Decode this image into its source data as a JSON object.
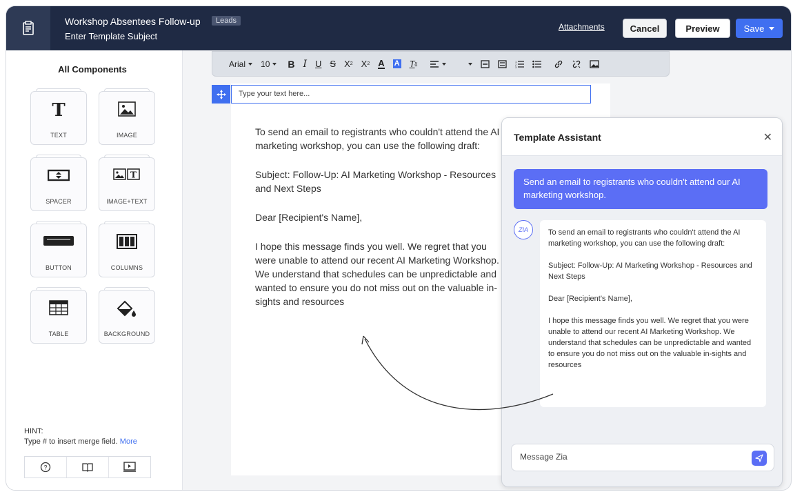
{
  "header": {
    "title": "Workshop Absentees Follow-up",
    "subtitle": "Enter Template Subject",
    "badge": "Leads",
    "attachments_label": "Attachments",
    "cancel_label": "Cancel",
    "preview_label": "Preview",
    "save_label": "Save"
  },
  "sidebar": {
    "title": "All Components",
    "components": [
      {
        "label": "TEXT",
        "icon": "text-icon"
      },
      {
        "label": "IMAGE",
        "icon": "image-icon"
      },
      {
        "label": "SPACER",
        "icon": "spacer-icon"
      },
      {
        "label": "IMAGE+TEXT",
        "icon": "image-text-icon"
      },
      {
        "label": "BUTTON",
        "icon": "button-icon"
      },
      {
        "label": "COLUMNS",
        "icon": "columns-icon"
      },
      {
        "label": "TABLE",
        "icon": "table-icon"
      },
      {
        "label": "BACKGROUND",
        "icon": "paint-bucket-icon"
      }
    ],
    "hint_label": "HINT:",
    "hint_text": "Type # to insert merge field.",
    "hint_more": "More"
  },
  "toolbar": {
    "font": "Arial",
    "size": "10"
  },
  "editor": {
    "subject_placeholder": "Type your text here...",
    "paragraphs": [
      "To send an email to registrants who couldn't attend the AI marketing workshop, you can use the following draft:",
      "Subject: Follow-Up: AI Marketing Workshop - Resources and Next Steps",
      "Dear [Recipient's Name],",
      "I hope this message finds you well. We regret that you were unable to attend our recent AI Marketing Workshop. We understand that schedules can be unpredictable and wanted to ensure you do not miss out on the valuable in-sights and resources"
    ]
  },
  "assistant": {
    "title": "Template Assistant",
    "user_message": "Send an email to registrants who couldn't attend our AI marketing workshop.",
    "avatar_label": "ZIA",
    "bot_paragraphs": [
      "To send an email to registrants who couldn't attend the AI marketing workshop, you can use the following draft:",
      "Subject: Follow-Up: AI Marketing Workshop - Resources and Next Steps",
      "Dear [Recipient's Name],",
      "I hope this message finds you well. We regret that you were unable to attend our recent AI Marketing Workshop. We understand that schedules can be unpredictable and wanted to ensure you do not miss out on the valuable in-sights and resources"
    ],
    "input_placeholder": "Message Zia"
  }
}
